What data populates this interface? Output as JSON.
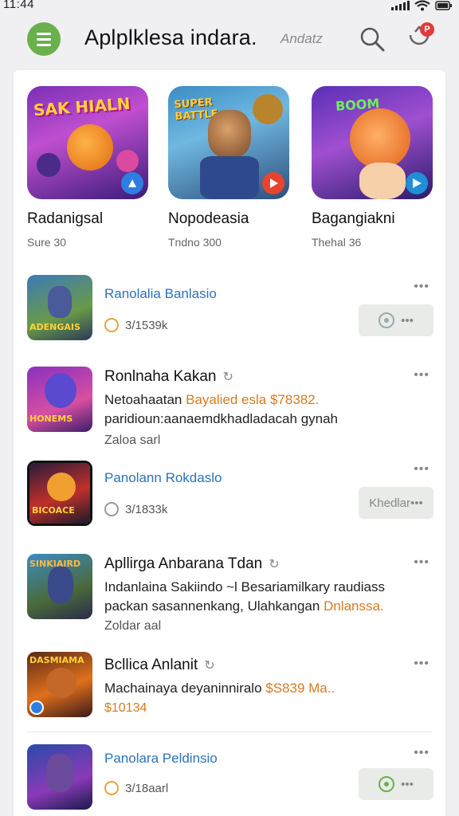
{
  "status": {
    "time": "11:44"
  },
  "header": {
    "title": "Aplplklesa indara.",
    "hint": "Andatz",
    "badge": "P"
  },
  "featured": [
    {
      "art": "SAK HIALN",
      "name": "Radanigsal",
      "sub": "Sure 30"
    },
    {
      "art": "SUPER BATTLE",
      "name": "Nopodeasia",
      "sub": "Tndno 300"
    },
    {
      "art": "BOOM",
      "name": "Bagangiakni",
      "sub": "Thehal 36"
    }
  ],
  "list": [
    {
      "thumb": "ADENGAIS",
      "title": "Ranolalia Banlasio",
      "meta": "3/1539k",
      "dots": "•••",
      "pill": "•••"
    },
    {
      "thumb": "HONEMS",
      "title": "Ronlnaha Kakan",
      "desc_a": "Netoahaatan",
      "desc_b": "Bayalied esla $78382.",
      "desc_c": "paridioun:aanaemdkhadladacah gynah",
      "sub": "Zaloa sarl",
      "dots": "•••"
    },
    {
      "thumb": "BICOACE",
      "title": "Panolann Rokdaslo",
      "meta": "3/1833k",
      "dots": "•••",
      "pill": "Khedlar•••"
    },
    {
      "thumb": "SINKIAIRD",
      "title": "Apllirga Anbarana Tdan",
      "desc_a": "Indanlaina Sakiindo ~l Besariamilkary raudiass",
      "desc_b": "packan sasannenkang, Ulahkangan",
      "desc_c": "Dnlanssa.",
      "sub": "Zoldar aal",
      "dots": "•••"
    },
    {
      "thumb": "DASMIAMA",
      "title": "Bcllica Anlanit",
      "desc_a": "Machainaya deyaninniralo",
      "desc_b": "$S839 Ma..",
      "sub": "$10134",
      "dots": "•••"
    },
    {
      "thumb": "",
      "title": "Panolara Peldinsio",
      "meta": "3/18aarl",
      "dots": "•••",
      "pill": "•••"
    }
  ],
  "colors": {
    "accent_green": "#6ab04c",
    "link_blue": "#2b73b9",
    "price_orange": "#d87a1e",
    "badge_red": "#e03b3b"
  }
}
